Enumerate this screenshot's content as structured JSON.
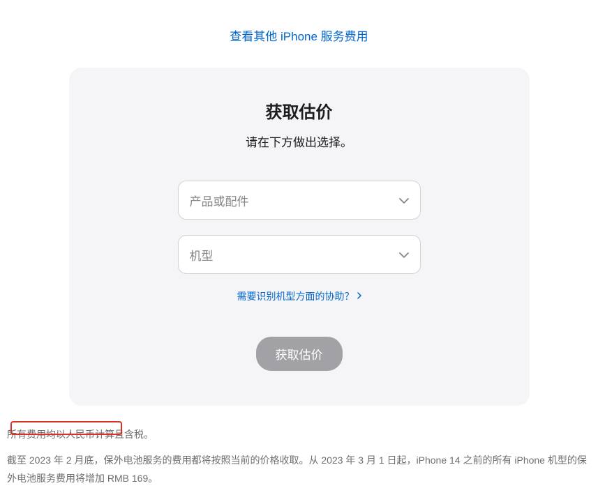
{
  "topLink": {
    "label": "查看其他 iPhone 服务费用"
  },
  "card": {
    "title": "获取估价",
    "subtitle": "请在下方做出选择。",
    "select1": {
      "placeholder": "产品或配件"
    },
    "select2": {
      "placeholder": "机型"
    },
    "helpLink": "需要识别机型方面的协助？",
    "submitLabel": "获取估价"
  },
  "footer": {
    "line1": "所有费用均以人民币计算且含税。",
    "line2": "截至 2023 年 2 月底，保外电池服务的费用都将按照当前的价格收取。从 2023 年 3 月 1 日起，iPhone 14 之前的所有 iPhone 机型的保外电池服务费用将增加 RMB 169。"
  }
}
